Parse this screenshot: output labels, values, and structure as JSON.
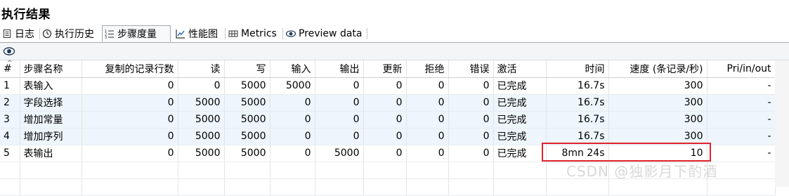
{
  "panel": {
    "title": "执行结果"
  },
  "tabs": [
    {
      "label": "日志",
      "icon": "log-icon",
      "active": false
    },
    {
      "label": "执行历史",
      "icon": "history-icon",
      "active": false
    },
    {
      "label": "步骤度量",
      "icon": "step-metrics-icon",
      "active": true
    },
    {
      "label": "性能图",
      "icon": "performance-graph-icon",
      "active": false
    },
    {
      "label": "Metrics",
      "icon": "metrics-icon",
      "active": false
    },
    {
      "label": "Preview data",
      "icon": "eye-icon",
      "active": false
    }
  ],
  "toolbar": {
    "icon": "eye-icon"
  },
  "table": {
    "sort_indicator": "^",
    "headers": [
      "#",
      "步骤名称",
      "复制的记录行数",
      "读",
      "写",
      "输入",
      "输出",
      "更新",
      "拒绝",
      "错误",
      "激活",
      "时间",
      "速度 (条记录/秒)",
      "Pri/in/out"
    ],
    "rows": [
      [
        "1",
        "表输入",
        "0",
        "0",
        "5000",
        "5000",
        "0",
        "0",
        "0",
        "0",
        "已完成",
        "16.7s",
        "300",
        "-"
      ],
      [
        "2",
        "字段选择",
        "0",
        "5000",
        "5000",
        "0",
        "0",
        "0",
        "0",
        "0",
        "已完成",
        "16.7s",
        "300",
        "-"
      ],
      [
        "3",
        "增加常量",
        "0",
        "5000",
        "5000",
        "0",
        "0",
        "0",
        "0",
        "0",
        "已完成",
        "16.7s",
        "300",
        "-"
      ],
      [
        "4",
        "增加序列",
        "0",
        "5000",
        "5000",
        "0",
        "0",
        "0",
        "0",
        "0",
        "已完成",
        "16.7s",
        "300",
        "-"
      ],
      [
        "5",
        "表输出",
        "0",
        "5000",
        "5000",
        "0",
        "5000",
        "0",
        "0",
        "0",
        "已完成",
        "8mn 24s",
        "10",
        "-"
      ]
    ]
  },
  "watermark": "CSDN @独影月下酌酒",
  "colors": {
    "highlight": "#e0242c",
    "row_alt": "#eef5fc",
    "tab_border": "#a8a8a8"
  }
}
